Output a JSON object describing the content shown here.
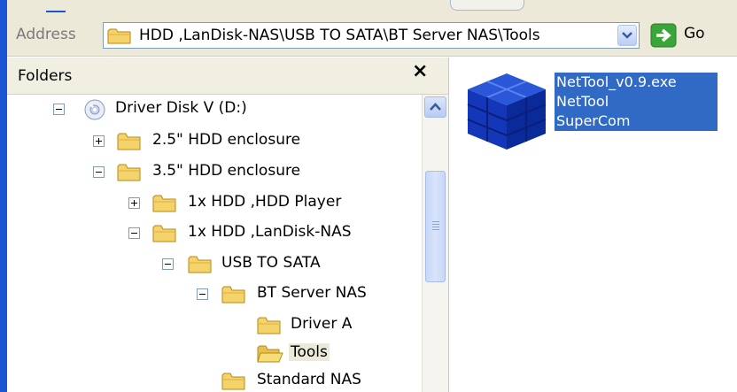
{
  "address_bar": {
    "label": "Address",
    "path": "HDD ,LanDisk-NAS\\USB TO SATA\\BT Server NAS\\Tools",
    "go_label": "Go"
  },
  "folders_pane": {
    "title": "Folders",
    "close_symbol": "×",
    "tree": [
      {
        "label": "Driver Disk V (D:)",
        "icon": "cd-drive-icon",
        "expander": "minus"
      },
      {
        "label": "2.5\" HDD enclosure",
        "icon": "folder-icon",
        "expander": "plus"
      },
      {
        "label": "3.5\" HDD enclosure",
        "icon": "folder-icon",
        "expander": "minus"
      },
      {
        "label": "1x HDD ,HDD Player",
        "icon": "folder-icon",
        "expander": "plus"
      },
      {
        "label": "1x HDD ,LanDisk-NAS",
        "icon": "folder-icon",
        "expander": "minus"
      },
      {
        "label": "USB TO SATA",
        "icon": "folder-icon",
        "expander": "minus"
      },
      {
        "label": "BT Server NAS",
        "icon": "folder-icon",
        "expander": "minus"
      },
      {
        "label": "Driver A",
        "icon": "folder-icon",
        "expander": "none"
      },
      {
        "label": "Tools",
        "icon": "folder-open-icon",
        "expander": "none",
        "selected": true
      },
      {
        "label": "Standard NAS",
        "icon": "folder-icon",
        "expander": "none"
      }
    ]
  },
  "content_pane": {
    "file": {
      "name": "NetTool_v0.9.exe",
      "description": "NetTool",
      "company": "SuperCom",
      "icon": "blue-cube-icon"
    }
  },
  "colors": {
    "selection": "#316ac5",
    "toolbar": "#ece9d8",
    "folder": "#f5d36b",
    "go_green": "#3aa63a"
  }
}
